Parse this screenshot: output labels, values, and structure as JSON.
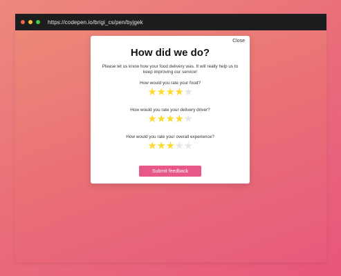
{
  "browser": {
    "url": "https://codepen.io/brigi_cs/pen/byjgek",
    "colors": {
      "close": "#f26457",
      "minimize": "#f6c12f",
      "maximize": "#3ec94a"
    }
  },
  "modal": {
    "close_label": "Close",
    "title": "How did we do?",
    "intro": "Please let us know how your food delivery was. It will really help us to keep improving our service!",
    "questions": [
      {
        "label": "How would you rate your food?",
        "rating": 4,
        "max": 5
      },
      {
        "label": "How would you rate your delivery driver?",
        "rating": 4,
        "max": 5
      },
      {
        "label": "How would you rate your overall experience?",
        "rating": 3,
        "max": 5
      }
    ],
    "submit_label": "Submit feedback",
    "colors": {
      "star_on": "#fcd931",
      "star_off": "#e6e6e6",
      "submit_bg": "#e8578a"
    }
  }
}
